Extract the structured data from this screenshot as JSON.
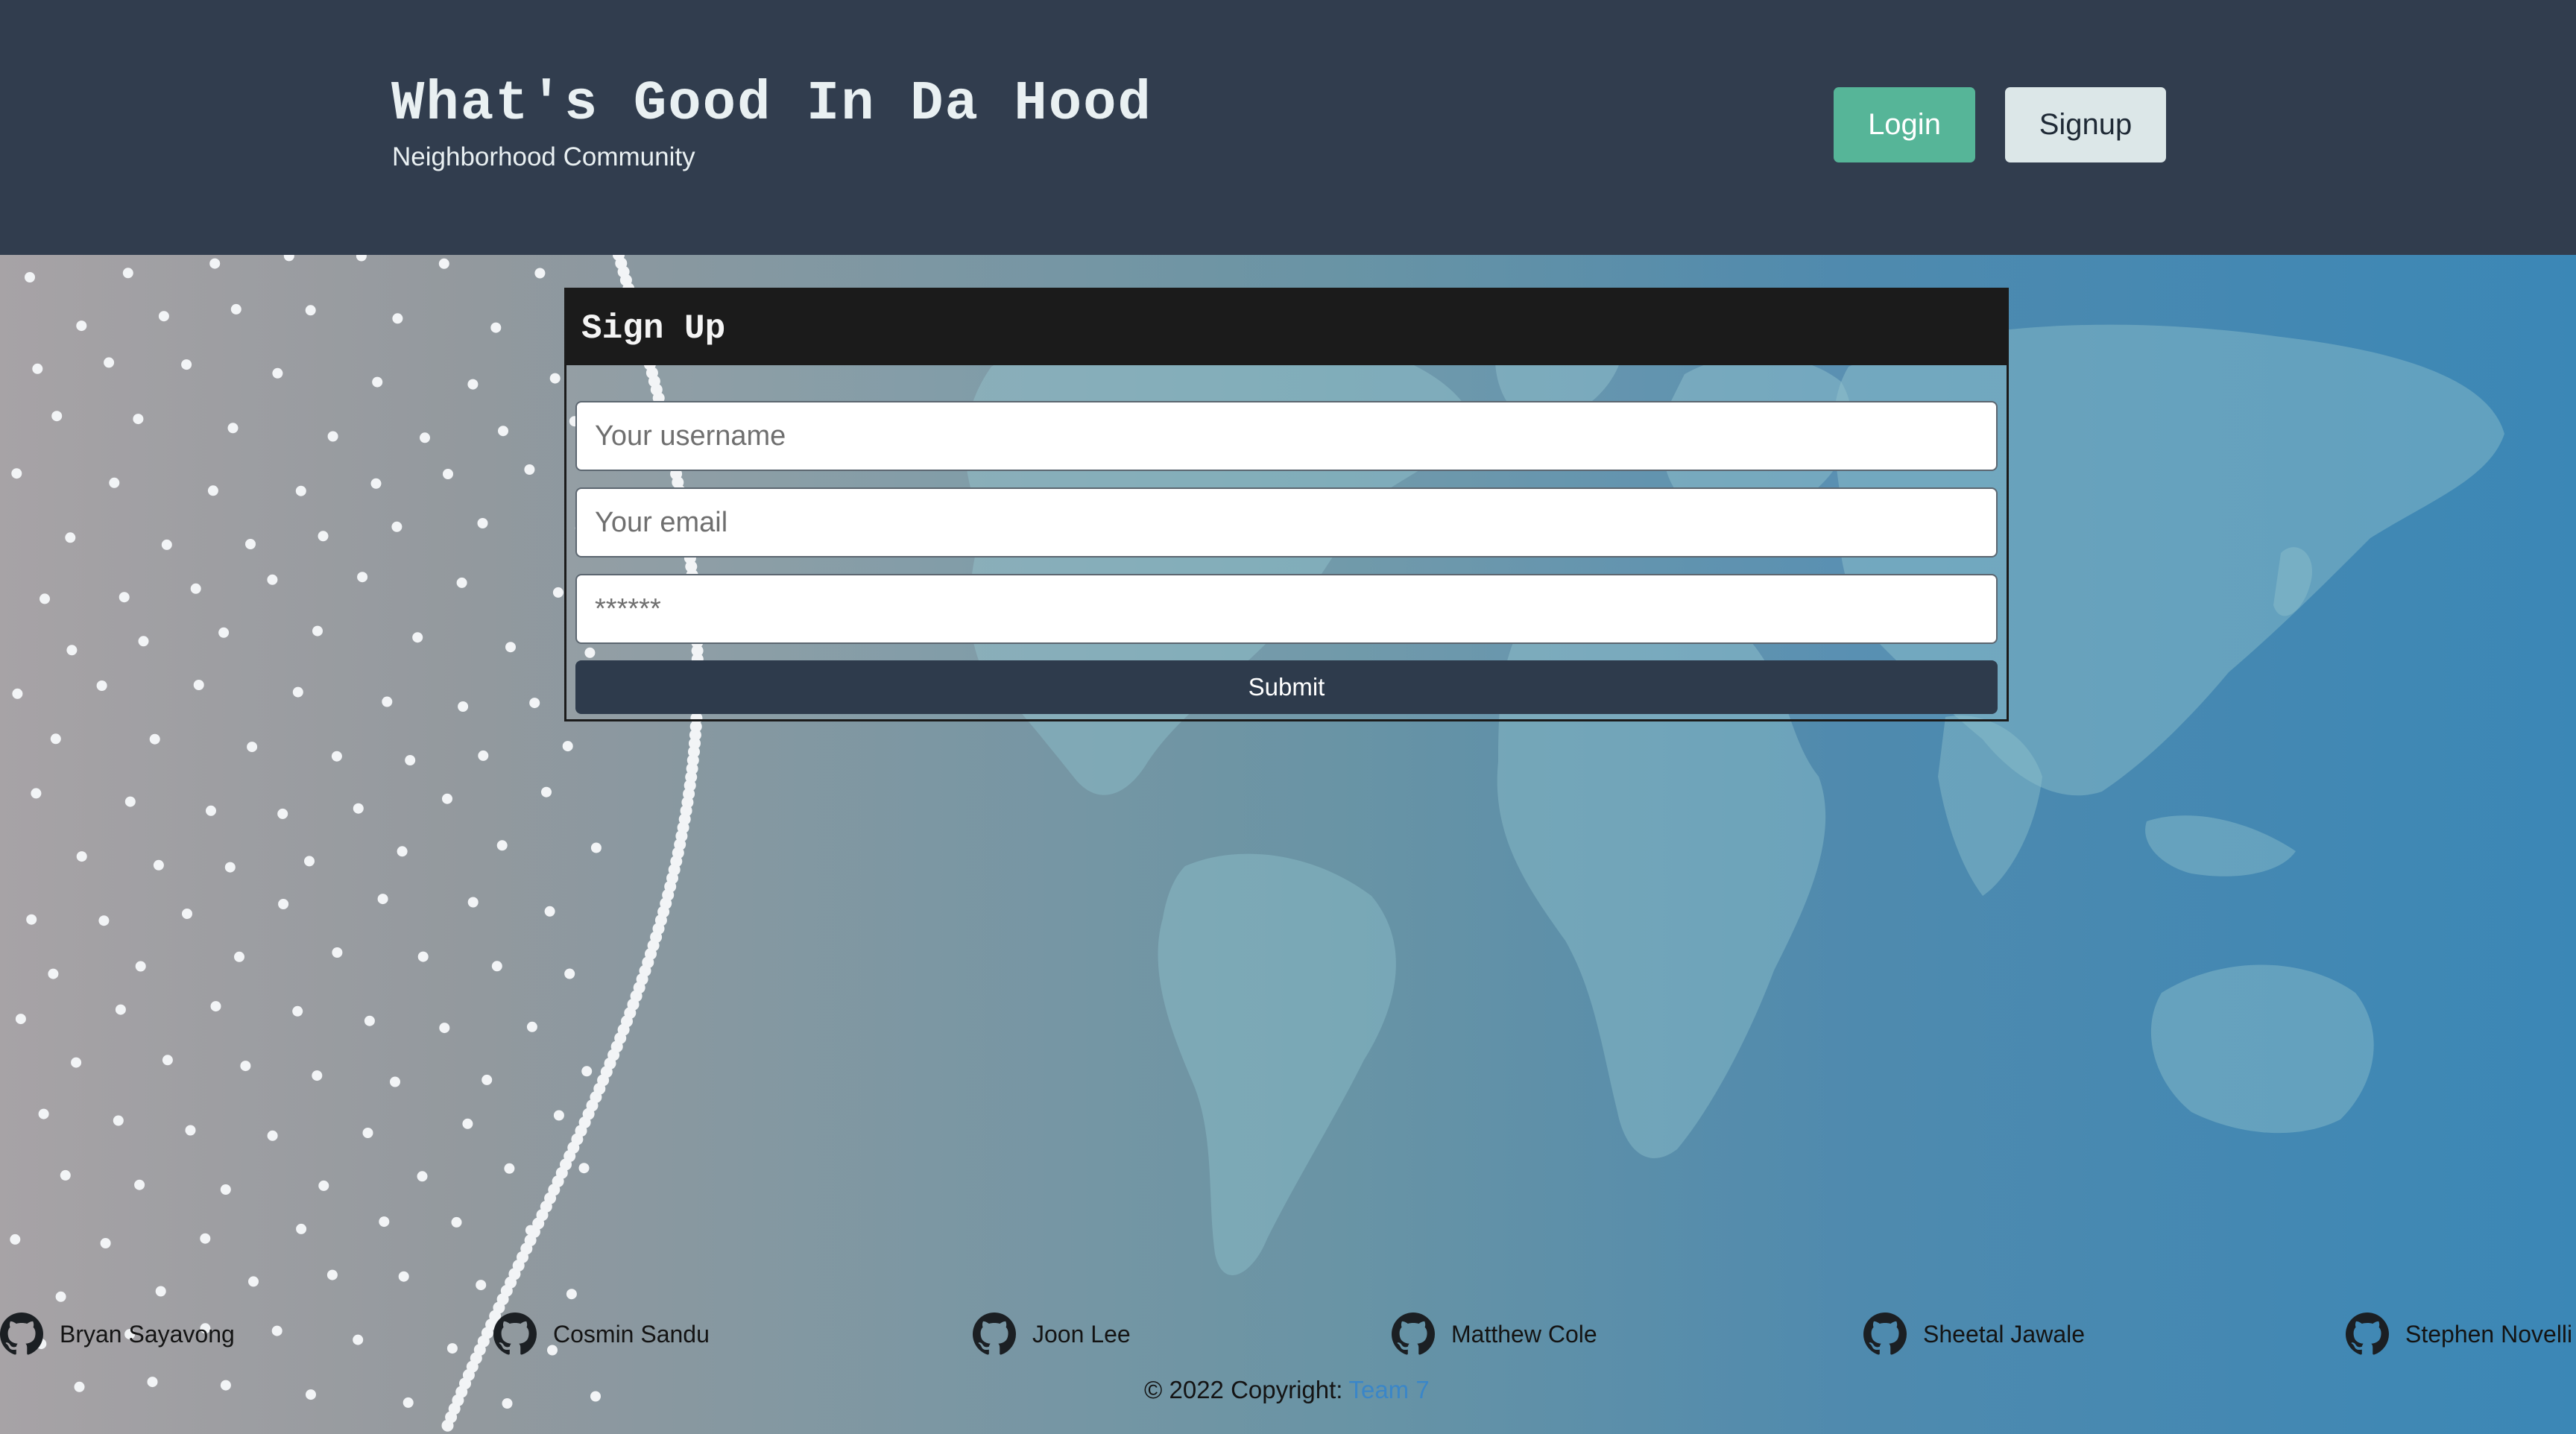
{
  "header": {
    "title": "What's Good In Da Hood",
    "subtitle": "Neighborhood Community",
    "login_label": "Login",
    "signup_label": "Signup"
  },
  "signup_form": {
    "title": "Sign Up",
    "username_placeholder": "Your username",
    "email_placeholder": "Your email",
    "password_placeholder": "******",
    "submit_label": "Submit"
  },
  "footer": {
    "contributors": [
      {
        "name": "Bryan Sayavong",
        "icon": "github-icon"
      },
      {
        "name": "Cosmin Sandu",
        "icon": "github-icon"
      },
      {
        "name": "Joon Lee",
        "icon": "github-icon"
      },
      {
        "name": "Matthew Cole",
        "icon": "github-icon"
      },
      {
        "name": "Sheetal Jawale",
        "icon": "github-icon"
      },
      {
        "name": "Stephen Novelli",
        "icon": "github-icon"
      }
    ],
    "copyright_text": "© 2022 Copyright:",
    "copyright_link": "Team 7"
  },
  "colors": {
    "header_bg": "#313d4e",
    "login_button": "#56b598",
    "signup_button": "#dce7e8",
    "card_header": "#1b1b1b",
    "submit_button": "#2e3b4c",
    "link": "#3a86c8"
  }
}
